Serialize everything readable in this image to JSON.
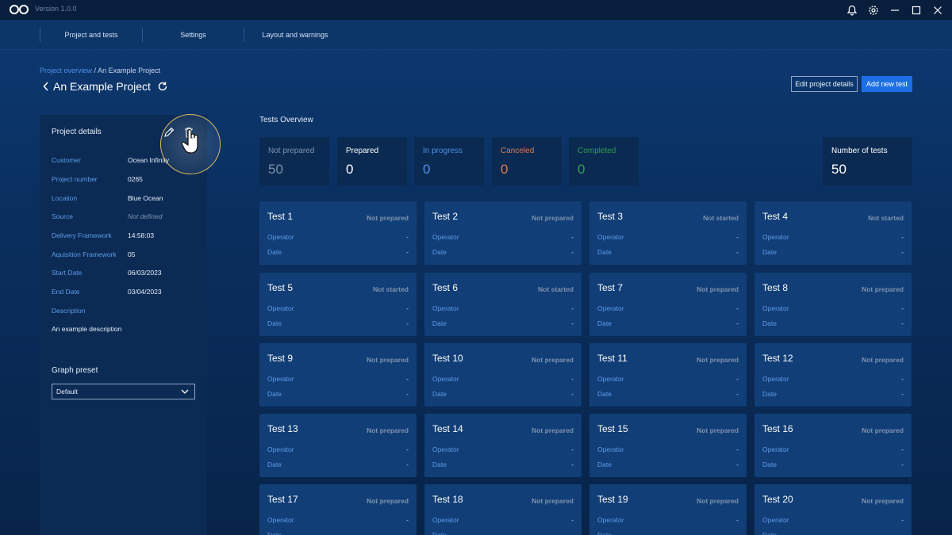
{
  "app": {
    "version": "Version 1.0.0"
  },
  "nav": {
    "tabs": [
      "Project and tests",
      "Settings",
      "Layout and warnings"
    ]
  },
  "breadcrumb": {
    "parent": "Project overview",
    "separator": "/",
    "current": "An Example Project"
  },
  "header": {
    "title": "An Example Project",
    "edit_label": "Edit project details",
    "add_label": "Add new test"
  },
  "details": {
    "title": "Project details",
    "rows": [
      {
        "key": "Customer",
        "value": "Ocean Infinity"
      },
      {
        "key": "Project number",
        "value": "0265"
      },
      {
        "key": "Location",
        "value": "Blue Ocean"
      },
      {
        "key": "Source",
        "value": "Not defined"
      },
      {
        "key": "Delivery Framework",
        "value": "14:58:03"
      },
      {
        "key": "Aquisition Framework",
        "value": "05"
      },
      {
        "key": "Start Date",
        "value": "06/03/2023"
      },
      {
        "key": "End Date",
        "value": "03/04/2023"
      },
      {
        "key": "Description",
        "value": ""
      }
    ],
    "description": "An example description",
    "graph_label": "Graph preset",
    "graph_value": "Default"
  },
  "overview": {
    "title": "Tests Overview",
    "stats": [
      {
        "label": "Not prepared",
        "value": "50",
        "color": "#7d92ad"
      },
      {
        "label": "Prepared",
        "value": "0",
        "color": "#ffffff"
      },
      {
        "label": "In progress",
        "value": "0",
        "color": "#4f8fe6"
      },
      {
        "label": "Canceled",
        "value": "0",
        "color": "#e0784a"
      },
      {
        "label": "Completed",
        "value": "0",
        "color": "#2fa14a"
      }
    ],
    "total": {
      "label": "Number of tests",
      "value": "50"
    }
  },
  "card_labels": {
    "operator": "Operator",
    "date": "Date"
  },
  "tests": [
    {
      "name": "Test 1",
      "status": "Not prepared",
      "operator": "-",
      "date": "-"
    },
    {
      "name": "Test 2",
      "status": "Not prepared",
      "operator": "-",
      "date": "-"
    },
    {
      "name": "Test 3",
      "status": "Not started",
      "operator": "-",
      "date": "-"
    },
    {
      "name": "Test 4",
      "status": "Not started",
      "operator": "-",
      "date": "-"
    },
    {
      "name": "Test 5",
      "status": "Not started",
      "operator": "-",
      "date": "-"
    },
    {
      "name": "Test 6",
      "status": "Not started",
      "operator": "-",
      "date": "-"
    },
    {
      "name": "Test 7",
      "status": "Not prepared",
      "operator": "-",
      "date": "-"
    },
    {
      "name": "Test 8",
      "status": "Not prepared",
      "operator": "-",
      "date": "-"
    },
    {
      "name": "Test 9",
      "status": "Not prepared",
      "operator": "-",
      "date": "-"
    },
    {
      "name": "Test 10",
      "status": "Not prepared",
      "operator": "-",
      "date": "-"
    },
    {
      "name": "Test 11",
      "status": "Not prepared",
      "operator": "-",
      "date": "-"
    },
    {
      "name": "Test 12",
      "status": "Not prepared",
      "operator": "-",
      "date": "-"
    },
    {
      "name": "Test 13",
      "status": "Not prepared",
      "operator": "-",
      "date": "-"
    },
    {
      "name": "Test 14",
      "status": "Not prepared",
      "operator": "-",
      "date": "-"
    },
    {
      "name": "Test 15",
      "status": "Not prepared",
      "operator": "-",
      "date": "-"
    },
    {
      "name": "Test 16",
      "status": "Not prepared",
      "operator": "-",
      "date": "-"
    },
    {
      "name": "Test 17",
      "status": "Not prepared",
      "operator": "-",
      "date": "-"
    },
    {
      "name": "Test 18",
      "status": "Not prepared",
      "operator": "-",
      "date": "-"
    },
    {
      "name": "Test 19",
      "status": "Not prepared",
      "operator": "-",
      "date": "-"
    },
    {
      "name": "Test 20",
      "status": "Not prepared",
      "operator": "-",
      "date": "-"
    }
  ]
}
